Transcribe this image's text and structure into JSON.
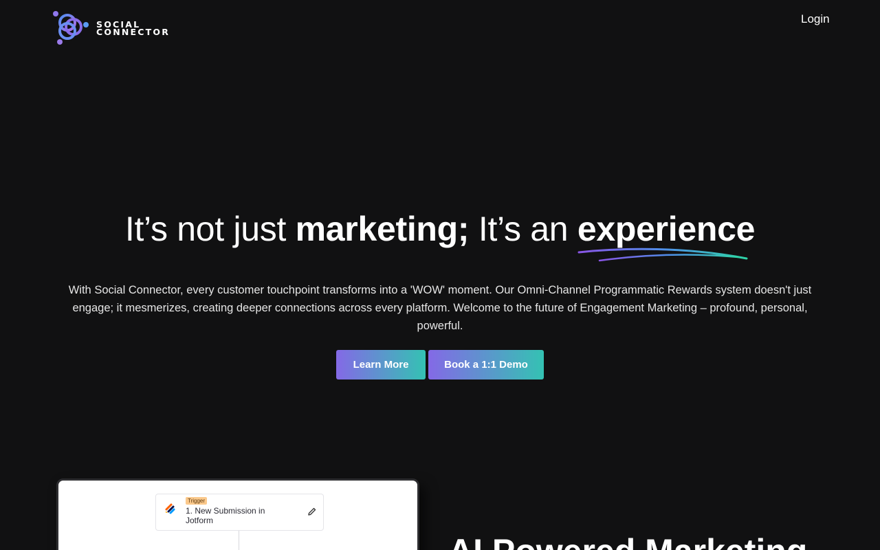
{
  "header": {
    "brand_line1": "SOCIAL",
    "brand_line2": "CONNECTOR",
    "login_label": "Login"
  },
  "hero": {
    "title_part1": "It’s not just ",
    "title_bold1": "marketing;",
    "title_part2": " It’s an ",
    "title_bold2": "experience",
    "subtitle": "With Social Connector, every customer touchpoint transforms into a 'WOW' moment. Our Omni-Channel Programmatic Rewards system doesn't just engage; it mesmerizes, creating deeper connections across every platform. Welcome to the future of Engagement Marketing – profound, personal, powerful.",
    "learn_more_label": "Learn More",
    "demo_label": "Book a 1:1 Demo"
  },
  "preview": {
    "trigger_tag": "Trigger",
    "trigger_text": "1. New Submission in Jotform"
  },
  "section": {
    "title": "AI Powered Marketing"
  },
  "colors": {
    "background": "#111112",
    "gradient_start": "#8469e6",
    "gradient_end": "#34c2b3"
  },
  "icons": {
    "logo": "interlocking-rings-logo-icon",
    "jotform": "jotform-icon",
    "edit": "pencil-icon"
  }
}
